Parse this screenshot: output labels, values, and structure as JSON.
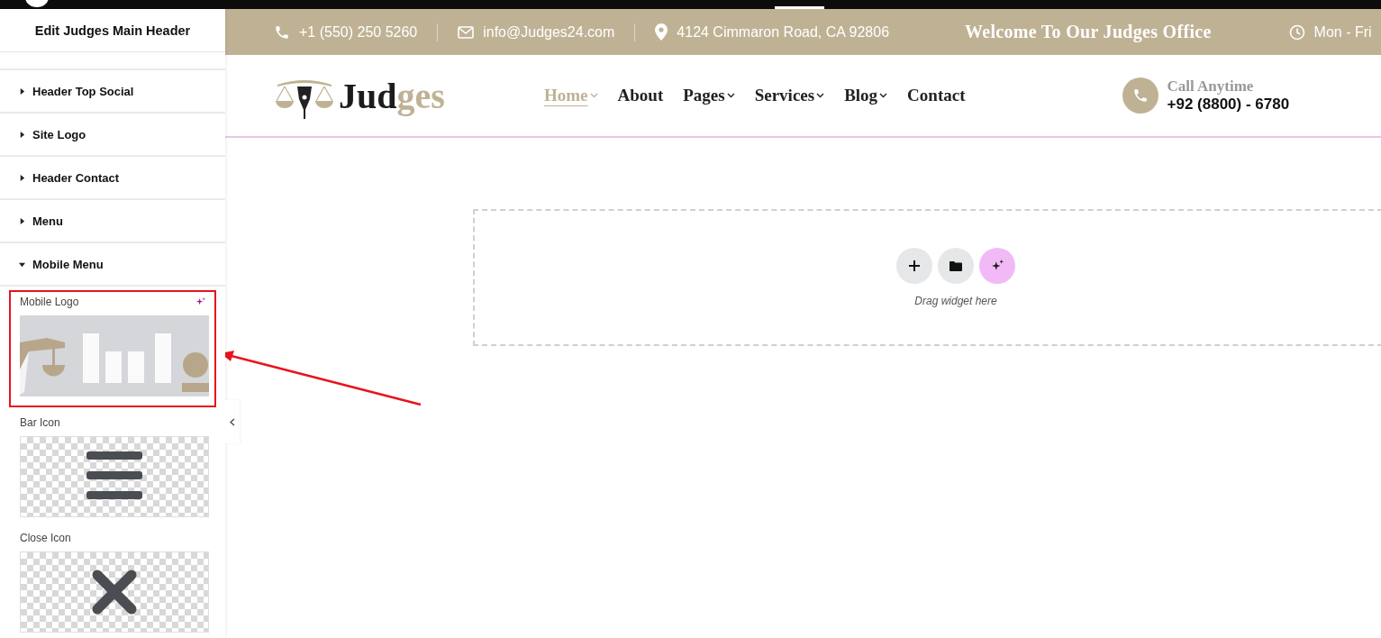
{
  "panel": {
    "title": "Edit Judges Main Header",
    "sections": [
      {
        "label": "Header Top Social",
        "expanded": false
      },
      {
        "label": "Site Logo",
        "expanded": false
      },
      {
        "label": "Header Contact",
        "expanded": false
      },
      {
        "label": "Menu",
        "expanded": false
      },
      {
        "label": "Mobile Menu",
        "expanded": true
      }
    ],
    "controls": [
      {
        "label": "Mobile Logo",
        "kind": "logo",
        "highlighted": true
      },
      {
        "label": "Bar Icon",
        "kind": "bars",
        "highlighted": false
      },
      {
        "label": "Close Icon",
        "kind": "close",
        "highlighted": false
      }
    ]
  },
  "topbar": {
    "phone": "+1 (550) 250 5260",
    "email": "info@Judges24.com",
    "address": "4124 Cimmaron Road, CA 92806",
    "welcome": "Welcome To Our Judges Office",
    "hours": "Mon - Fri"
  },
  "header": {
    "logo": [
      "Jud",
      "ges"
    ],
    "nav": [
      {
        "label": "Home",
        "selected": true,
        "dropdown": true
      },
      {
        "label": "About",
        "selected": false,
        "dropdown": false
      },
      {
        "label": "Pages",
        "selected": false,
        "dropdown": true
      },
      {
        "label": "Services",
        "selected": false,
        "dropdown": true
      },
      {
        "label": "Blog",
        "selected": false,
        "dropdown": true
      },
      {
        "label": "Contact",
        "selected": false,
        "dropdown": false
      }
    ],
    "call_label": "Call Anytime",
    "call_number": "+92 (8800) - 6780"
  },
  "dropzone": {
    "hint": "Drag widget here"
  }
}
